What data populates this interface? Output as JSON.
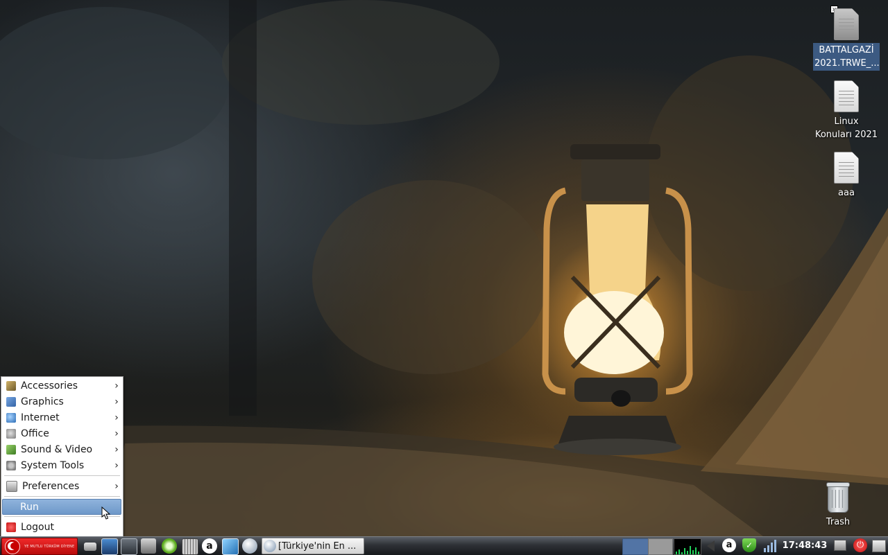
{
  "desktop": {
    "icons": [
      {
        "name": "BATTALGAZİ\n2021.TRWE_...",
        "selected": true
      },
      {
        "name": "Linux\nKonuları 2021"
      },
      {
        "name": "aaa"
      }
    ],
    "trash": {
      "label": "Trash"
    }
  },
  "start_menu": {
    "items": [
      {
        "label": "Accessories",
        "icon": "accessories-icon",
        "has_submenu": true
      },
      {
        "label": "Graphics",
        "icon": "graphics-icon",
        "has_submenu": true
      },
      {
        "label": "Internet",
        "icon": "internet-globe-icon",
        "has_submenu": true
      },
      {
        "label": "Office",
        "icon": "office-icon",
        "has_submenu": true
      },
      {
        "label": "Sound & Video",
        "icon": "sound-video-icon",
        "has_submenu": true
      },
      {
        "label": "System Tools",
        "icon": "system-tools-icon",
        "has_submenu": true
      }
    ],
    "preferences": {
      "label": "Preferences",
      "icon": "preferences-icon"
    },
    "run": {
      "label": "Run",
      "highlighted": true
    },
    "logout": {
      "label": "Logout",
      "icon": "logout-icon"
    },
    "submenu_arrow": "›"
  },
  "taskbar": {
    "start_button": {
      "text": "YE MUTLU TÜRKÜM DİYENE"
    },
    "launchers": [
      "show-desktop-icon",
      "system-monitor-icon",
      "terminal-screen-icon",
      "screenshot-camera-icon",
      "green-app-icon",
      "calculator-icon",
      "a-app-icon",
      "image-viewer-icon",
      "web-browser-icon"
    ],
    "tasks": [
      {
        "title": "[Türkiye'nin En ..."
      }
    ],
    "clock": "17:48:43",
    "a_letter": "a",
    "shield_glyph": "✓",
    "power_glyph": "⏻"
  },
  "colors": {
    "menu_highlight": "#7ca3d2",
    "start_red": "#d81616",
    "selected_icon_bg": "#3c5a82",
    "pager_active": "#5274a5"
  }
}
